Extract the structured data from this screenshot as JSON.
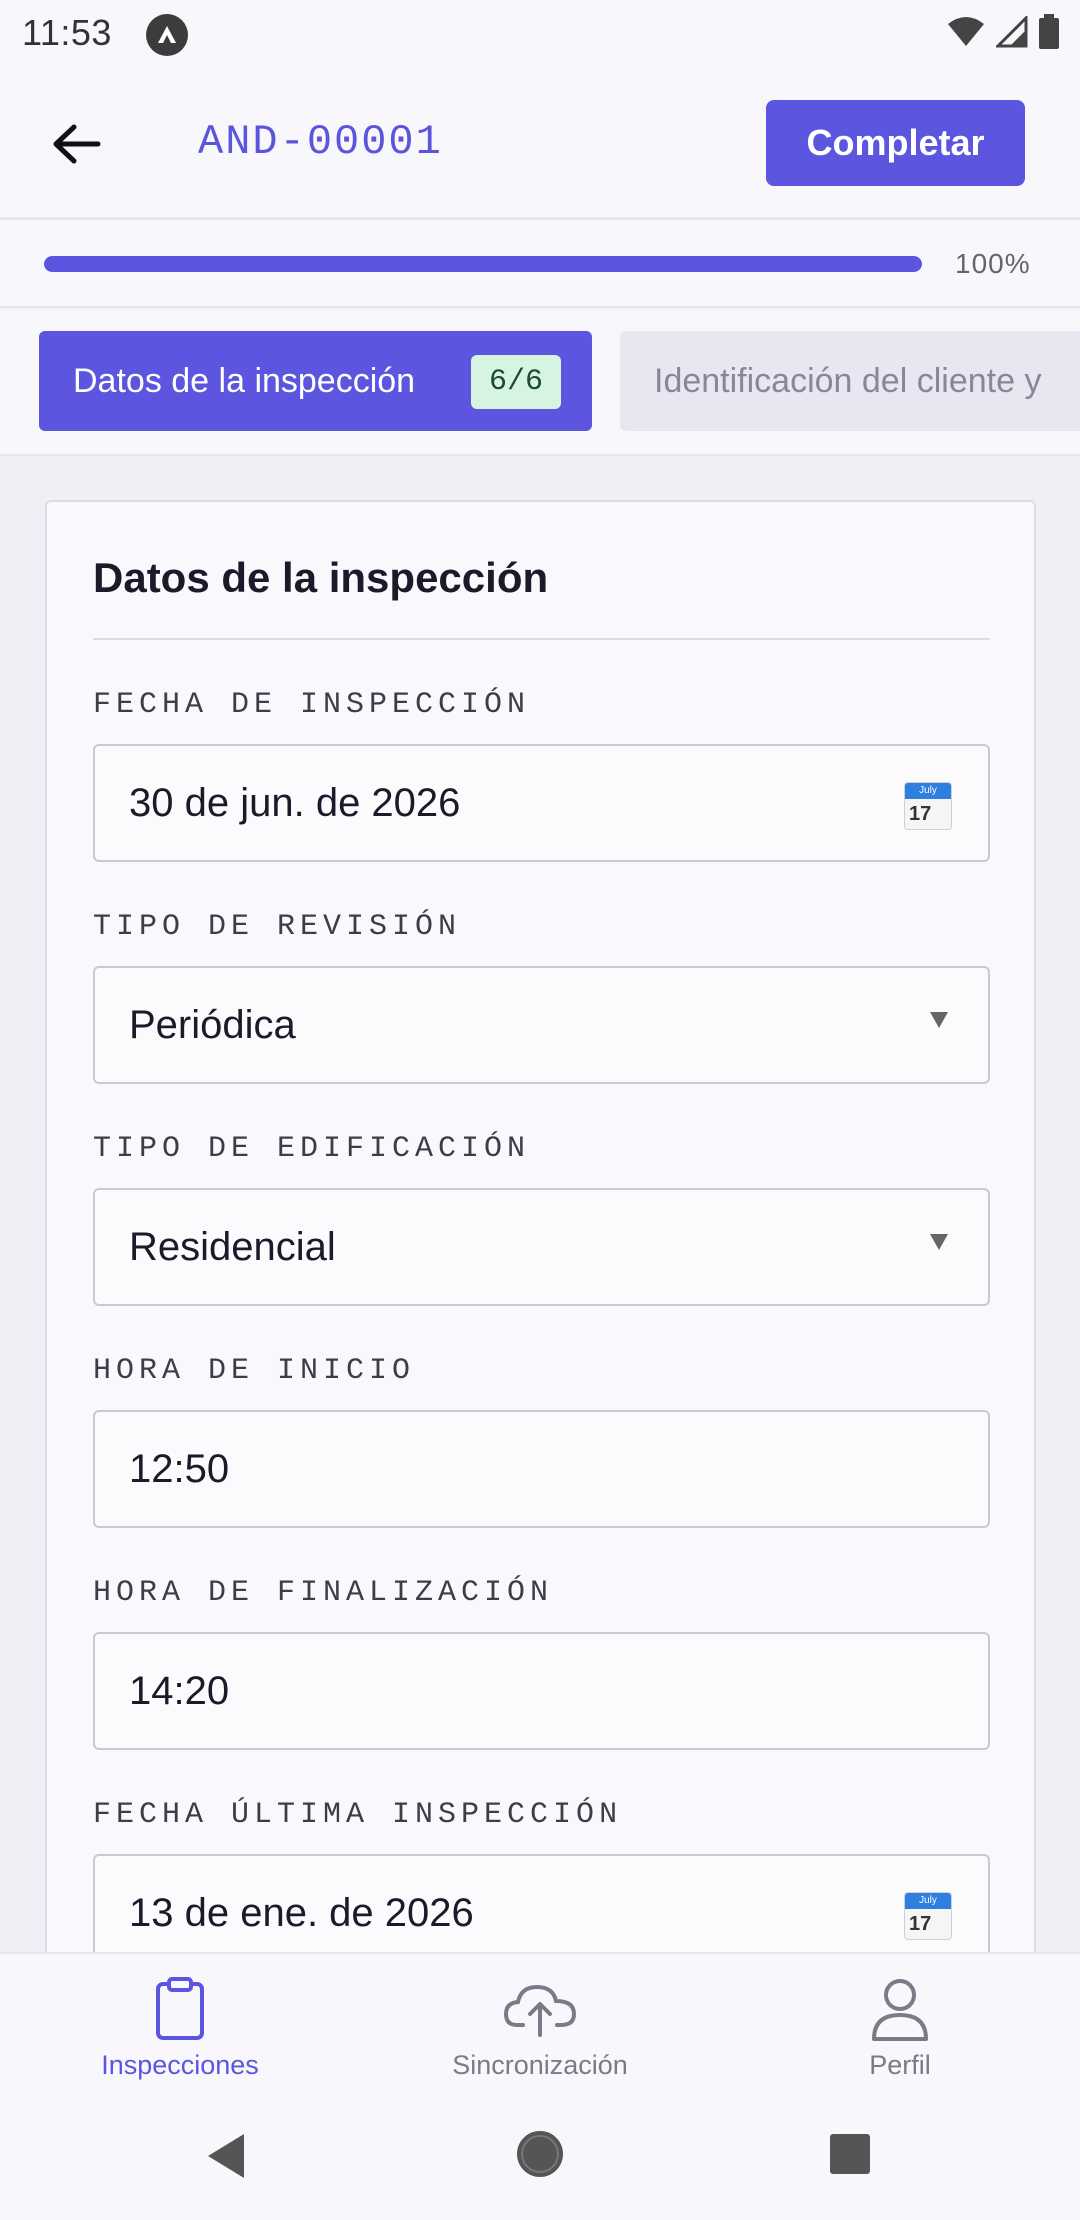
{
  "status_bar": {
    "time": "11:53"
  },
  "app_bar": {
    "record_id": "AND-00001",
    "complete_label": "Completar"
  },
  "progress": {
    "value": 1.0,
    "label": "100%"
  },
  "tabs": [
    {
      "label": "Datos de la inspección",
      "badge": "6/6",
      "active": true
    },
    {
      "label": "Identificación del cliente y",
      "active": false
    }
  ],
  "card": {
    "title": "Datos de la inspección",
    "fields": [
      {
        "label": "FECHA DE INSPECCIÓN",
        "value": "30 de jun. de 2026",
        "kind": "date",
        "icon": "calendar-icon",
        "icon_month": "July",
        "icon_day": "17"
      },
      {
        "label": "TIPO DE REVISIÓN",
        "value": "Periódica",
        "kind": "select"
      },
      {
        "label": "TIPO DE EDIFICACIÓN",
        "value": "Residencial",
        "kind": "select"
      },
      {
        "label": "HORA DE INICIO",
        "value": "12:50",
        "kind": "time"
      },
      {
        "label": "HORA DE FINALIZACIÓN",
        "value": "14:20",
        "kind": "time"
      },
      {
        "label": "FECHA ÚLTIMA INSPECCIÓN",
        "value": "13 de ene. de 2026",
        "kind": "date",
        "icon": "calendar-icon",
        "icon_month": "July",
        "icon_day": "17"
      }
    ]
  },
  "bottom_nav": [
    {
      "label": "Inspecciones",
      "icon": "clipboard-icon",
      "active": true
    },
    {
      "label": "Sincronización",
      "icon": "cloud-upload-icon",
      "active": false
    },
    {
      "label": "Perfil",
      "icon": "person-icon",
      "active": false
    }
  ],
  "colors": {
    "accent": "#5b55e0",
    "badge_bg": "#d7f4e3",
    "inactive_nav": "#7a7a88"
  }
}
